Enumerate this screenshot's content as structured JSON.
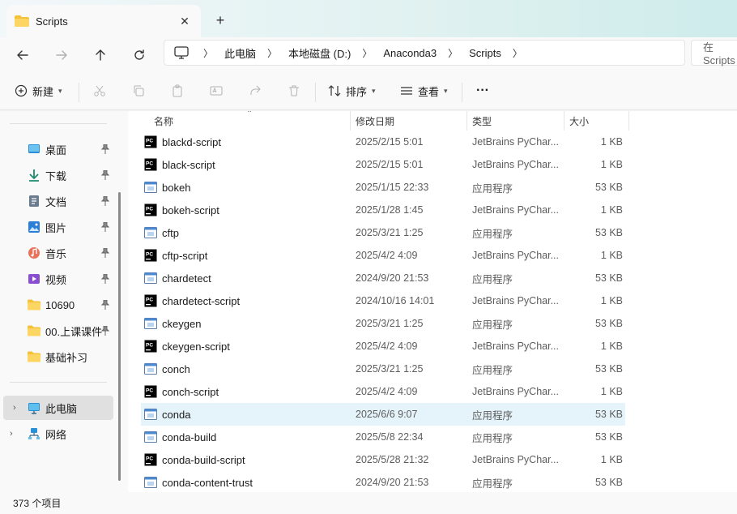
{
  "tab": {
    "title": "Scripts"
  },
  "address": {
    "crumbs": [
      "此电脑",
      "本地磁盘 (D:)",
      "Anaconda3",
      "Scripts"
    ],
    "search_placeholder": "在 Scripts"
  },
  "toolbar": {
    "new_label": "新建",
    "sort_label": "排序",
    "view_label": "查看",
    "more": "···"
  },
  "sidebar": {
    "items": [
      {
        "label": "桌面",
        "icon": "desktop-icon",
        "pinned": true
      },
      {
        "label": "下载",
        "icon": "download-icon",
        "pinned": true
      },
      {
        "label": "文档",
        "icon": "document-icon",
        "pinned": true
      },
      {
        "label": "图片",
        "icon": "pictures-icon",
        "pinned": true
      },
      {
        "label": "音乐",
        "icon": "music-icon",
        "pinned": true
      },
      {
        "label": "视频",
        "icon": "video-icon",
        "pinned": true
      },
      {
        "label": "10690",
        "icon": "folder-icon",
        "pinned": true
      },
      {
        "label": "00.上课课件.",
        "icon": "folder-icon",
        "pinned": true
      },
      {
        "label": "基础补习",
        "icon": "folder-icon",
        "pinned": false
      }
    ],
    "this_pc": "此电脑",
    "network": "网络"
  },
  "columns": {
    "name": "名称",
    "date": "修改日期",
    "type": "类型",
    "size": "大小"
  },
  "files": [
    {
      "name": "blackd-script",
      "date": "2025/2/15 5:01",
      "type": "JetBrains PyChar...",
      "size": "1 KB",
      "kind": "py"
    },
    {
      "name": "black-script",
      "date": "2025/2/15 5:01",
      "type": "JetBrains PyChar...",
      "size": "1 KB",
      "kind": "py"
    },
    {
      "name": "bokeh",
      "date": "2025/1/15 22:33",
      "type": "应用程序",
      "size": "53 KB",
      "kind": "exe"
    },
    {
      "name": "bokeh-script",
      "date": "2025/1/28 1:45",
      "type": "JetBrains PyChar...",
      "size": "1 KB",
      "kind": "py"
    },
    {
      "name": "cftp",
      "date": "2025/3/21 1:25",
      "type": "应用程序",
      "size": "53 KB",
      "kind": "exe"
    },
    {
      "name": "cftp-script",
      "date": "2025/4/2 4:09",
      "type": "JetBrains PyChar...",
      "size": "1 KB",
      "kind": "py"
    },
    {
      "name": "chardetect",
      "date": "2024/9/20 21:53",
      "type": "应用程序",
      "size": "53 KB",
      "kind": "exe"
    },
    {
      "name": "chardetect-script",
      "date": "2024/10/16 14:01",
      "type": "JetBrains PyChar...",
      "size": "1 KB",
      "kind": "py"
    },
    {
      "name": "ckeygen",
      "date": "2025/3/21 1:25",
      "type": "应用程序",
      "size": "53 KB",
      "kind": "exe"
    },
    {
      "name": "ckeygen-script",
      "date": "2025/4/2 4:09",
      "type": "JetBrains PyChar...",
      "size": "1 KB",
      "kind": "py"
    },
    {
      "name": "conch",
      "date": "2025/3/21 1:25",
      "type": "应用程序",
      "size": "53 KB",
      "kind": "exe"
    },
    {
      "name": "conch-script",
      "date": "2025/4/2 4:09",
      "type": "JetBrains PyChar...",
      "size": "1 KB",
      "kind": "py"
    },
    {
      "name": "conda",
      "date": "2025/6/6 9:07",
      "type": "应用程序",
      "size": "53 KB",
      "kind": "exe",
      "selected": true
    },
    {
      "name": "conda-build",
      "date": "2025/5/8 22:34",
      "type": "应用程序",
      "size": "53 KB",
      "kind": "exe"
    },
    {
      "name": "conda-build-script",
      "date": "2025/5/28 21:32",
      "type": "JetBrains PyChar...",
      "size": "1 KB",
      "kind": "py"
    },
    {
      "name": "conda-content-trust",
      "date": "2024/9/20 21:53",
      "type": "应用程序",
      "size": "53 KB",
      "kind": "exe"
    }
  ],
  "status": {
    "item_count": "373 个项目"
  }
}
